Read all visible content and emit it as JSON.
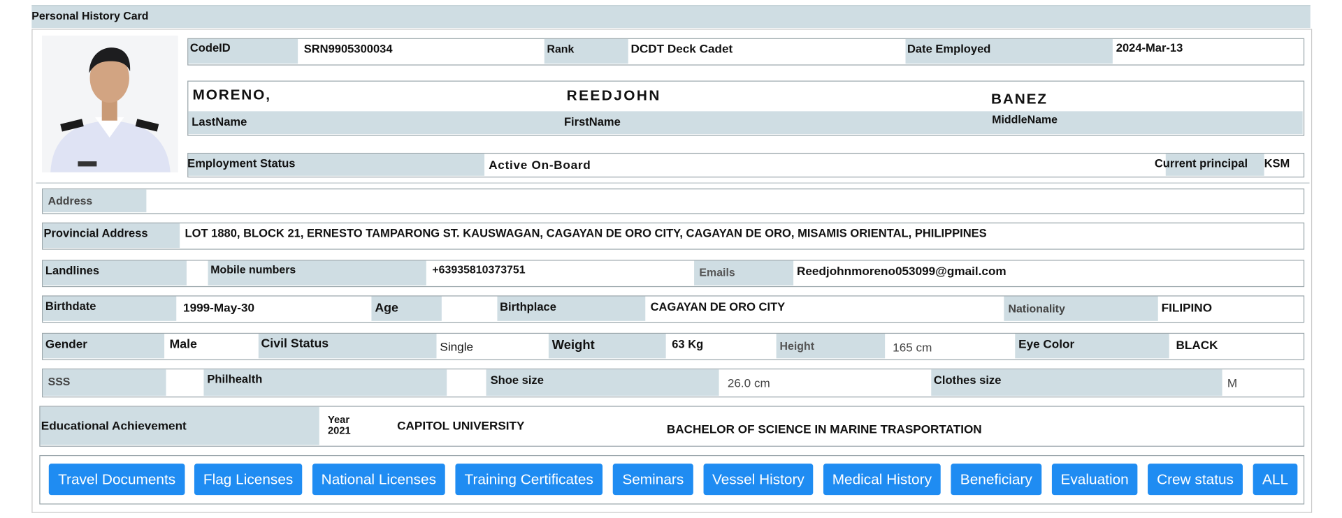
{
  "header": {
    "title": "Personal History Card"
  },
  "top": {
    "code_label": "CodeID",
    "code_value": "SRN9905300034",
    "rank_label": "Rank",
    "rank_value": "DCDT Deck Cadet",
    "date_label": "Date Employed",
    "date_value": "2024-Mar-13"
  },
  "name": {
    "last": "MORENO,",
    "first": "REEDJOHN",
    "middle": "BANEZ",
    "last_label": "LastName",
    "first_label": "FirstName",
    "middle_label": "MiddleName"
  },
  "employment": {
    "label": "Employment Status",
    "value": "Active On-Board",
    "principal_label": "Current principal",
    "principal_value": "KSM"
  },
  "address": {
    "label": "Address",
    "value": ""
  },
  "provincial": {
    "label": "Provincial Address",
    "value": "LOT 1880, BLOCK 21, ERNESTO TAMPARONG ST. KAUSWAGAN, CAGAYAN DE ORO CITY, CAGAYAN DE ORO, MISAMIS ORIENTAL, PHILIPPINES"
  },
  "contacts": {
    "landlines_label": "Landlines",
    "mobile_label": "Mobile numbers",
    "mobile_value": "+63935810373751",
    "emails_label": "Emails",
    "emails_value": "Reedjohnmoreno053099@gmail.com"
  },
  "birth": {
    "birthdate_label": "Birthdate",
    "birthdate_value": "1999-May-30",
    "age_label": "Age",
    "birthplace_label": "Birthplace",
    "birthplace_value": "CAGAYAN DE ORO CITY",
    "nationality_label": "Nationality",
    "nationality_value": "FILIPINO"
  },
  "physical": {
    "gender_label": "Gender",
    "gender_value": "Male",
    "civil_label": "Civil Status",
    "civil_value": "Single",
    "weight_label": "Weight",
    "weight_value": "63 Kg",
    "height_label": "Height",
    "height_value": "165 cm",
    "eye_label": "Eye Color",
    "eye_value": "BLACK"
  },
  "ids": {
    "sss_label": "SSS",
    "philhealth_label": "Philhealth",
    "shoe_label": "Shoe size",
    "shoe_value": "26.0 cm",
    "clothes_label": "Clothes size",
    "clothes_value": "M"
  },
  "education": {
    "label": "Educational Achievement",
    "year_label": "Year",
    "year_value": "2021",
    "school": "CAPITOL UNIVERSITY",
    "course": "BACHELOR OF SCIENCE IN MARINE TRASPORTATION"
  },
  "buttons": [
    "Travel Documents",
    "Flag Licenses",
    "National Licenses",
    "Training Certificates",
    "Seminars",
    "Vessel History",
    "Medical History",
    "Beneficiary",
    "Evaluation",
    "Crew status",
    "ALL"
  ],
  "colors": {
    "accent": "#1f8cf2",
    "label_bg": "#cfdde3"
  },
  "icons": {
    "photo": "person-photo-icon"
  }
}
